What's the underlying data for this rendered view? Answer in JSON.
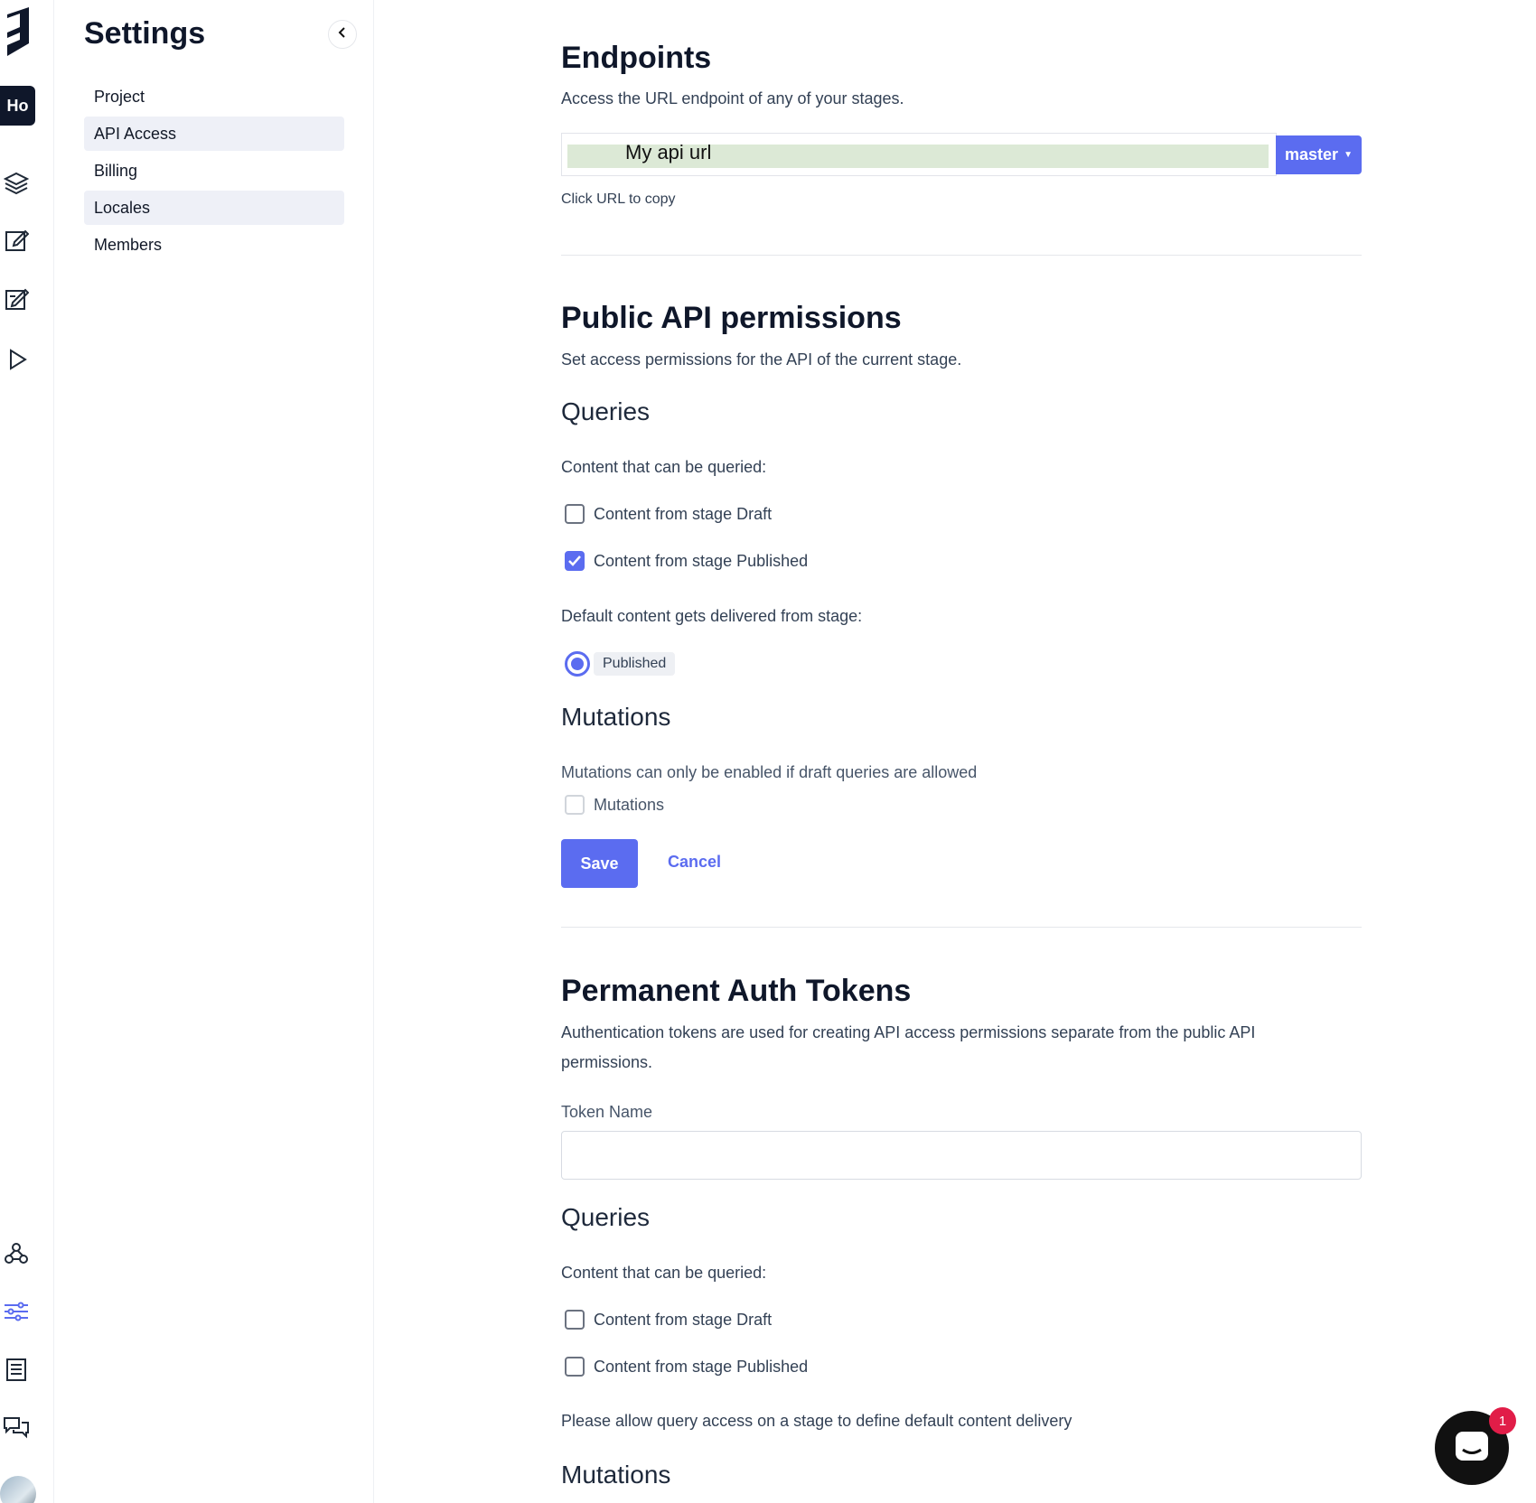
{
  "rail": {
    "project_initials": "Ho"
  },
  "sidebar": {
    "title": "Settings",
    "items": [
      {
        "label": "Project"
      },
      {
        "label": "API Access"
      },
      {
        "label": "Billing"
      },
      {
        "label": "Locales"
      },
      {
        "label": "Members"
      }
    ]
  },
  "endpoints": {
    "title": "Endpoints",
    "description": "Access the URL endpoint of any of your stages.",
    "url_value": "My api url",
    "stage": "master",
    "hint": "Click URL to copy"
  },
  "public_api": {
    "title": "Public API permissions",
    "description": "Set access permissions for the API of the current stage.",
    "queries_title": "Queries",
    "queries_label": "Content that can be queried:",
    "draft_label": "Content from stage Draft",
    "draft_checked": false,
    "published_label": "Content from stage Published",
    "published_checked": true,
    "default_label": "Default content gets delivered from stage:",
    "default_stage": "Published",
    "mutations_title": "Mutations",
    "mutations_note": "Mutations can only be enabled if draft queries are allowed",
    "mutations_label": "Mutations",
    "save_label": "Save",
    "cancel_label": "Cancel"
  },
  "tokens": {
    "title": "Permanent Auth Tokens",
    "description_line1": "Authentication tokens are used for creating API access permissions separate from the public API",
    "description_line2": "permissions.",
    "token_name_label": "Token Name",
    "token_name_value": "",
    "queries_title": "Queries",
    "queries_label": "Content that can be queried:",
    "draft_label": "Content from stage Draft",
    "published_label": "Content from stage Published",
    "note": "Please allow query access on a stage to define default content delivery",
    "mutations_title": "Mutations"
  },
  "chat": {
    "badge_count": "1"
  },
  "colors": {
    "accent": "#5b6cf0",
    "url_highlight": "#dce9d6",
    "dark": "#0f172a"
  }
}
